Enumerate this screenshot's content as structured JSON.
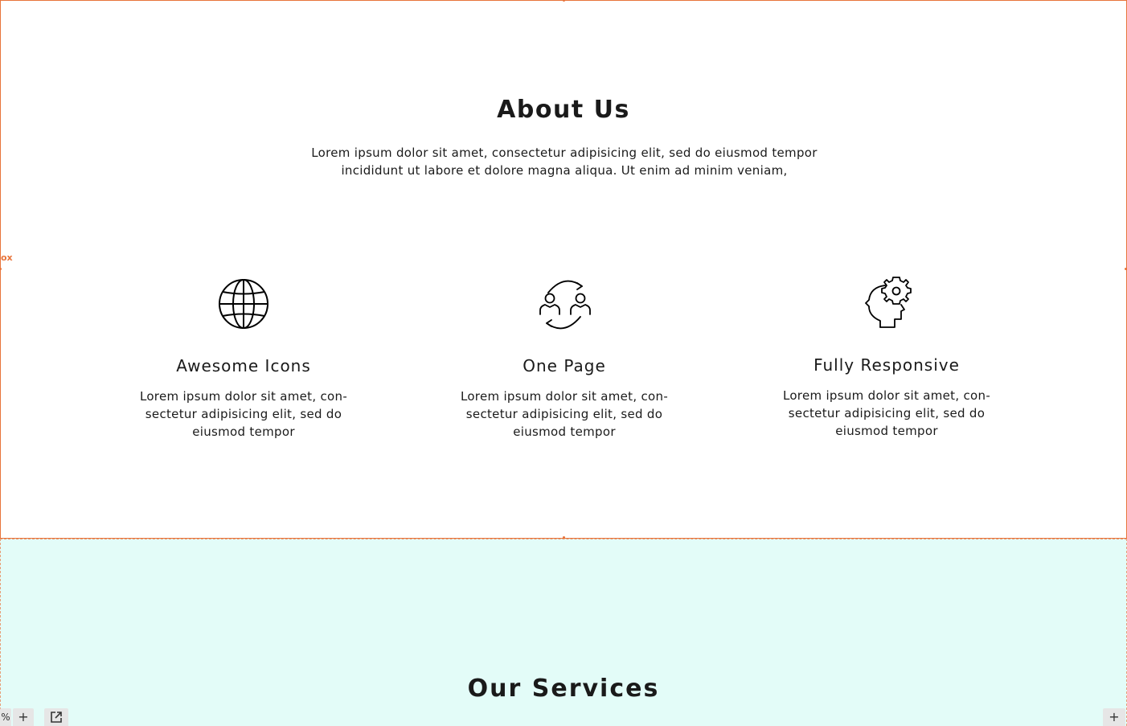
{
  "about": {
    "title": "About Us",
    "text": "Lorem ipsum dolor sit amet, consectetur adipisicing elit, sed do eiusmod tempor incididunt ut labore et dolore magna aliqua. Ut enim ad minim veniam,",
    "side_label": "ox",
    "features": [
      {
        "icon": "globe-icon",
        "title": "Awesome Icons",
        "text": "Lorem ipsum dolor sit amet, con-sectetur adipisicing elit, sed do eiusmod tempor"
      },
      {
        "icon": "user-exchange-icon",
        "title": "One Page",
        "text": "Lorem ipsum dolor sit amet, con-sectetur adipisicing elit, sed do eiusmod tempor"
      },
      {
        "icon": "head-gear-icon",
        "title": "Fully Responsive",
        "text": "Lorem ipsum dolor sit amet, con-sectetur adipisicing elit, sed do eiusmod tempor"
      }
    ]
  },
  "services": {
    "title": "Our Services"
  },
  "toolbar": {
    "zoom_suffix": "%",
    "add_label": "+",
    "add_right_label": "+"
  },
  "colors": {
    "accent": "#e8743b",
    "services_bg": "#e3fcf8",
    "text": "#1a1a1a"
  }
}
